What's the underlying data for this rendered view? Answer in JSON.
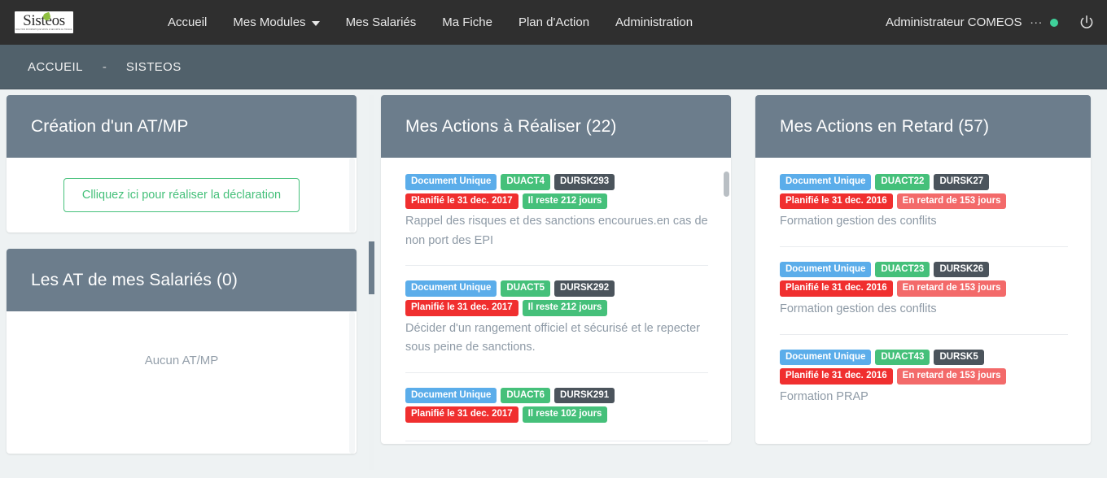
{
  "navbar": {
    "brand": {
      "word": "Sisteos",
      "tagline": "SOLUTION INFORMATIQUE SANTE & SECURITE AU TRAVAIL",
      "leaf_icon": "leaf-icon"
    },
    "links": [
      {
        "label": "Accueil",
        "has_caret": false
      },
      {
        "label": "Mes Modules",
        "has_caret": true
      },
      {
        "label": "Mes Salariés",
        "has_caret": false
      },
      {
        "label": "Ma Fiche",
        "has_caret": false
      },
      {
        "label": "Plan d'Action",
        "has_caret": false
      },
      {
        "label": "Administration",
        "has_caret": false
      }
    ],
    "user": "Administrateur COMEOS",
    "dots": "...",
    "status_color": "#3fd19a",
    "power_icon": "power-icon"
  },
  "breadcrumb": {
    "items": [
      "ACCUEIL",
      "SISTEOS"
    ],
    "separator": "-"
  },
  "cards": {
    "creation": {
      "title": "Création d'un AT/MP",
      "button_label": "Clliquez ici pour réaliser la déclaration"
    },
    "salaries": {
      "title": "Les AT de mes Salariés (0)",
      "empty_text": "Aucun AT/MP"
    },
    "a_realiser": {
      "title": "Mes Actions à Réaliser (22)",
      "items": [
        {
          "badges": [
            {
              "text": "Document Unique",
              "color": "blue"
            },
            {
              "text": "DUACT4",
              "color": "green"
            },
            {
              "text": "DURSK293",
              "color": "dark"
            }
          ],
          "badges2": [
            {
              "text": "Planifié le 31 dec. 2017",
              "color": "red"
            },
            {
              "text": "Il reste 212 jours",
              "color": "green"
            }
          ],
          "description": "Rappel des risques et des sanctions encourues.en cas de non port des EPI"
        },
        {
          "badges": [
            {
              "text": "Document Unique",
              "color": "blue"
            },
            {
              "text": "DUACT5",
              "color": "green"
            },
            {
              "text": "DURSK292",
              "color": "dark"
            }
          ],
          "badges2": [
            {
              "text": "Planifié le 31 dec. 2017",
              "color": "red"
            },
            {
              "text": "Il reste 212 jours",
              "color": "green"
            }
          ],
          "description": "Décider d'un rangement officiel et sécurisé et le repecter sous peine de sanctions."
        },
        {
          "badges": [
            {
              "text": "Document Unique",
              "color": "blue"
            },
            {
              "text": "DUACT6",
              "color": "green"
            },
            {
              "text": "DURSK291",
              "color": "dark"
            }
          ],
          "badges2": [
            {
              "text": "Planifié le 31 dec. 2017",
              "color": "red"
            },
            {
              "text": "Il reste 102 jours",
              "color": "green"
            }
          ],
          "description": ""
        }
      ]
    },
    "en_retard": {
      "title": "Mes Actions en Retard (57)",
      "items": [
        {
          "badges": [
            {
              "text": "Document Unique",
              "color": "blue"
            },
            {
              "text": "DUACT22",
              "color": "green"
            },
            {
              "text": "DURSK27",
              "color": "dark"
            }
          ],
          "badges2": [
            {
              "text": "Planifié le 31 dec. 2016",
              "color": "red"
            },
            {
              "text": "En retard de 153 jours",
              "color": "lightred"
            }
          ],
          "description": "Formation gestion des conflits"
        },
        {
          "badges": [
            {
              "text": "Document Unique",
              "color": "blue"
            },
            {
              "text": "DUACT23",
              "color": "green"
            },
            {
              "text": "DURSK26",
              "color": "dark"
            }
          ],
          "badges2": [
            {
              "text": "Planifié le 31 dec. 2016",
              "color": "red"
            },
            {
              "text": "En retard de 153 jours",
              "color": "lightred"
            }
          ],
          "description": "Formation gestion des conflits"
        },
        {
          "badges": [
            {
              "text": "Document Unique",
              "color": "blue"
            },
            {
              "text": "DUACT43",
              "color": "green"
            },
            {
              "text": "DURSK5",
              "color": "dark"
            }
          ],
          "badges2": [
            {
              "text": "Planifié le 31 dec. 2016",
              "color": "red"
            },
            {
              "text": "En retard de 153 jours",
              "color": "lightred"
            }
          ],
          "description": "Formation PRAP"
        }
      ]
    }
  },
  "colors": {
    "navbar_bg": "#2f2f2f",
    "breadcrumb_bg": "#51616b",
    "card_head_bg": "#6c7d8c",
    "page_bg": "#eef2f3",
    "accent_green": "#45c07a",
    "badge_blue": "#5badea",
    "badge_dark": "#4b545c",
    "badge_red": "#f02f2f",
    "badge_lightred": "#f36a6a"
  }
}
